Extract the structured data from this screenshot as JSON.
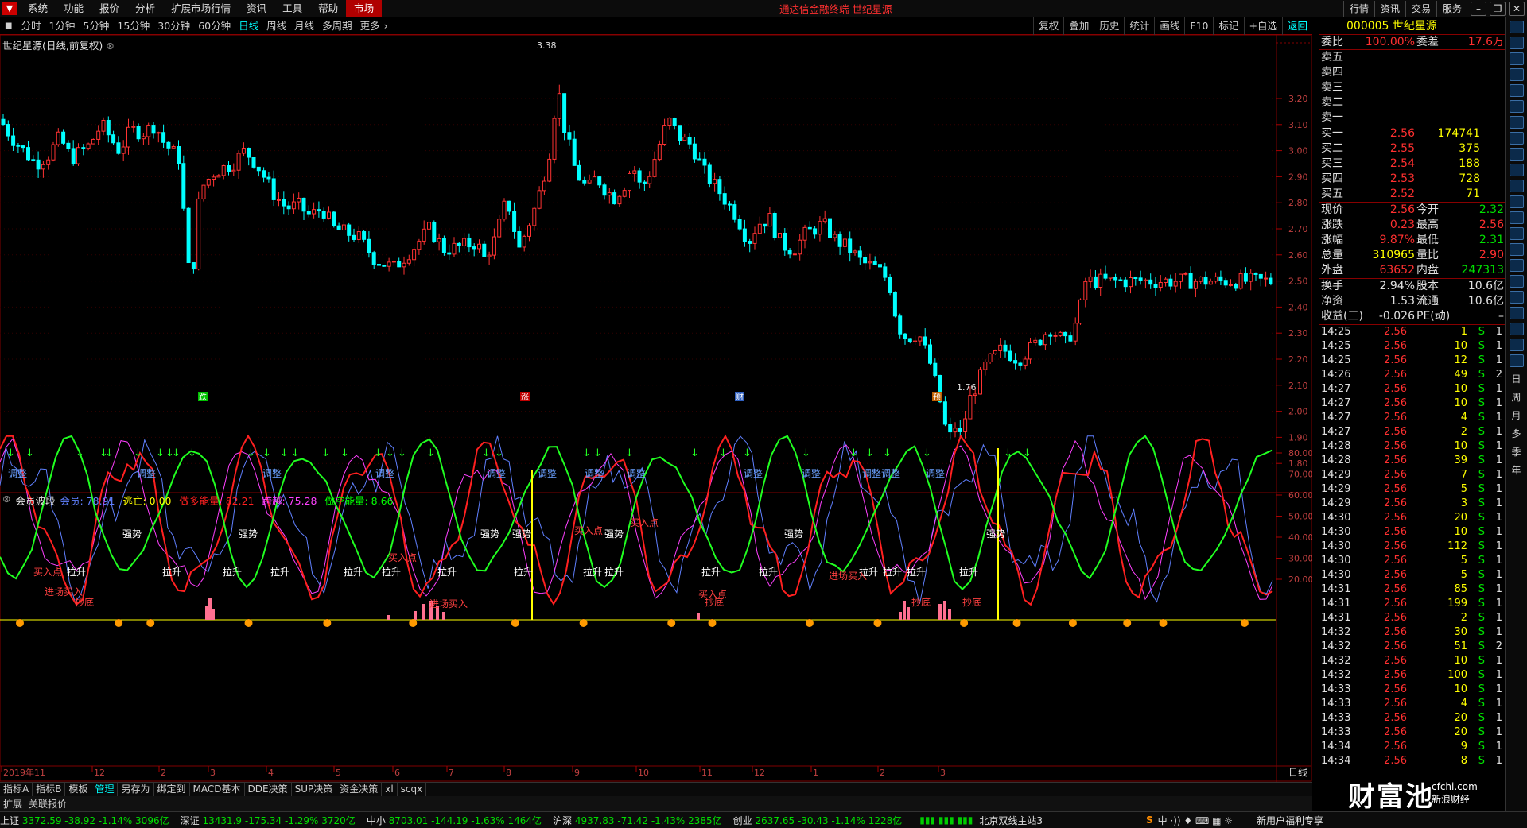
{
  "menubar": {
    "items": [
      "系统",
      "功能",
      "报价",
      "分析",
      "扩展市场行情",
      "资讯",
      "工具",
      "帮助"
    ],
    "market_label": "市场",
    "center_title": "通达信金融终端  世纪星源",
    "right_buttons": [
      "行情",
      "资讯",
      "交易",
      "服务"
    ]
  },
  "toolbar": {
    "periods": [
      "分时",
      "1分钟",
      "5分钟",
      "15分钟",
      "30分钟",
      "60分钟",
      "日线",
      "周线",
      "月线",
      "多周期",
      "更多"
    ],
    "active_period": "日线",
    "tools": [
      "复权",
      "叠加",
      "历史",
      "统计",
      "画线",
      "F10",
      "标记",
      "+自选",
      "返回"
    ]
  },
  "chart": {
    "title": "世纪星源(日线,前复权)",
    "high_label": "3.38",
    "low_label": "1.76",
    "y_ticks": [
      "3.20",
      "3.10",
      "3.00",
      "2.90",
      "2.80",
      "2.70",
      "2.60",
      "2.50",
      "2.40",
      "2.30",
      "2.20",
      "2.10",
      "2.00",
      "1.90",
      "1.80"
    ],
    "markers": [
      {
        "text": "跌",
        "color": "#00c000"
      },
      {
        "text": "涨",
        "color": "#c00000"
      },
      {
        "text": "财",
        "color": "#3060c0"
      },
      {
        "text": "预",
        "color": "#c06000"
      }
    ]
  },
  "indicator": {
    "name": "会员波段",
    "items": [
      {
        "label": "会员: 78.91",
        "color": "#6080ff"
      },
      {
        "label": "逃亡: 0.00",
        "color": "#ffff00"
      },
      {
        "label": "做多能量: 82.21",
        "color": "#ff2020"
      },
      {
        "label": "跨越: 75.28",
        "color": "#ff40ff"
      },
      {
        "label": "做空能量: 8.66",
        "color": "#00ff00"
      }
    ],
    "y_ticks": [
      "80.00",
      "70.00",
      "60.00",
      "50.00",
      "40.00",
      "30.00",
      "20.00"
    ],
    "labels_white": [
      "强势",
      "拉升",
      "调整"
    ],
    "labels_red": [
      "买入点",
      "抄底",
      "进场买入"
    ]
  },
  "xaxis": {
    "labels": [
      "2019年11",
      "12",
      "2",
      "3",
      "4",
      "5",
      "6",
      "7",
      "8",
      "9",
      "10",
      "11",
      "12",
      "1",
      "2",
      "3"
    ],
    "period_label": "日线"
  },
  "bottom_tabs": [
    "指标A",
    "指标B",
    "模板",
    "管理",
    "另存为",
    "绑定到",
    "MACD基本",
    "DDE决策",
    "SUP决策",
    "资金决策",
    "xl",
    "scqx"
  ],
  "active_tab": "管理",
  "ext_row": [
    "扩展",
    "关联报价"
  ],
  "status_indices": [
    {
      "name": "上证",
      "value": "3372.59  -38.92  -1.14%  3096亿"
    },
    {
      "name": "深证",
      "value": "13431.9 -175.34  -1.29%  3720亿"
    },
    {
      "name": "中小",
      "value": "8703.01 -144.19  -1.63%  1464亿"
    },
    {
      "name": "沪深",
      "value": "4937.83  -71.42  -1.43%  2385亿"
    },
    {
      "name": "创业",
      "value": "2637.65  -30.43  -1.14%  1228亿"
    }
  ],
  "status_right": "北京双线主站3",
  "status_news": "新用户福利专享",
  "quote": {
    "code_name": "000005 世纪星源",
    "weibi_label": "委比",
    "weibi": "100.00%",
    "weicha_label": "委差",
    "weicha": "17.6万",
    "sells": [
      {
        "label": "卖五"
      },
      {
        "label": "卖四"
      },
      {
        "label": "卖三"
      },
      {
        "label": "卖二"
      },
      {
        "label": "卖一"
      }
    ],
    "buys": [
      {
        "label": "买一",
        "price": "2.56",
        "vol": "174741"
      },
      {
        "label": "买二",
        "price": "2.55",
        "vol": "375"
      },
      {
        "label": "买三",
        "price": "2.54",
        "vol": "188"
      },
      {
        "label": "买四",
        "price": "2.53",
        "vol": "728"
      },
      {
        "label": "买五",
        "price": "2.52",
        "vol": "71"
      }
    ],
    "stats": [
      {
        "l1": "现价",
        "v1": "2.56",
        "c1": "#ff3030",
        "l2": "今开",
        "v2": "2.32",
        "c2": "#00e000"
      },
      {
        "l1": "涨跌",
        "v1": "0.23",
        "c1": "#ff3030",
        "l2": "最高",
        "v2": "2.56",
        "c2": "#ff3030"
      },
      {
        "l1": "涨幅",
        "v1": "9.87%",
        "c1": "#ff3030",
        "l2": "最低",
        "v2": "2.31",
        "c2": "#00e000"
      },
      {
        "l1": "总量",
        "v1": "310965",
        "c1": "#ffff00",
        "l2": "量比",
        "v2": "2.90",
        "c2": "#ff3030"
      },
      {
        "l1": "外盘",
        "v1": "63652",
        "c1": "#ff3030",
        "l2": "内盘",
        "v2": "247313",
        "c2": "#00e000"
      }
    ],
    "stats2": [
      {
        "l1": "换手",
        "v1": "2.94%",
        "l2": "股本",
        "v2": "10.6亿"
      },
      {
        "l1": "净资",
        "v1": "1.53",
        "l2": "流通",
        "v2": "10.6亿"
      },
      {
        "l1": "收益(三)",
        "v1": "-0.026",
        "l2": "PE(动)",
        "v2": "–"
      }
    ],
    "ticks": [
      [
        "14:25",
        "2.56",
        "1",
        "S",
        "1"
      ],
      [
        "14:25",
        "2.56",
        "10",
        "S",
        "1"
      ],
      [
        "14:25",
        "2.56",
        "12",
        "S",
        "1"
      ],
      [
        "14:26",
        "2.56",
        "49",
        "S",
        "2"
      ],
      [
        "14:27",
        "2.56",
        "10",
        "S",
        "1"
      ],
      [
        "14:27",
        "2.56",
        "10",
        "S",
        "1"
      ],
      [
        "14:27",
        "2.56",
        "4",
        "S",
        "1"
      ],
      [
        "14:27",
        "2.56",
        "2",
        "S",
        "1"
      ],
      [
        "14:28",
        "2.56",
        "10",
        "S",
        "1"
      ],
      [
        "14:28",
        "2.56",
        "39",
        "S",
        "1"
      ],
      [
        "14:29",
        "2.56",
        "7",
        "S",
        "1"
      ],
      [
        "14:29",
        "2.56",
        "5",
        "S",
        "1"
      ],
      [
        "14:29",
        "2.56",
        "3",
        "S",
        "1"
      ],
      [
        "14:30",
        "2.56",
        "20",
        "S",
        "1"
      ],
      [
        "14:30",
        "2.56",
        "10",
        "S",
        "1"
      ],
      [
        "14:30",
        "2.56",
        "112",
        "S",
        "1"
      ],
      [
        "14:30",
        "2.56",
        "5",
        "S",
        "1"
      ],
      [
        "14:30",
        "2.56",
        "5",
        "S",
        "1"
      ],
      [
        "14:31",
        "2.56",
        "85",
        "S",
        "1"
      ],
      [
        "14:31",
        "2.56",
        "199",
        "S",
        "1"
      ],
      [
        "14:31",
        "2.56",
        "2",
        "S",
        "1"
      ],
      [
        "14:32",
        "2.56",
        "30",
        "S",
        "1"
      ],
      [
        "14:32",
        "2.56",
        "51",
        "S",
        "2"
      ],
      [
        "14:32",
        "2.56",
        "10",
        "S",
        "1"
      ],
      [
        "14:32",
        "2.56",
        "100",
        "S",
        "1"
      ],
      [
        "14:33",
        "2.56",
        "10",
        "S",
        "1"
      ],
      [
        "14:33",
        "2.56",
        "4",
        "S",
        "1"
      ],
      [
        "14:33",
        "2.56",
        "20",
        "S",
        "1"
      ],
      [
        "14:33",
        "2.56",
        "20",
        "S",
        "1"
      ],
      [
        "14:34",
        "2.56",
        "9",
        "S",
        "1"
      ],
      [
        "14:34",
        "2.56",
        "8",
        "S",
        "1"
      ]
    ]
  },
  "sidebar_text": [
    "日",
    "周",
    "月",
    "多",
    "季",
    "年"
  ],
  "watermark": "财富池",
  "watermark_url": "cfchi.com",
  "watermark_sub": "新浪财经"
}
